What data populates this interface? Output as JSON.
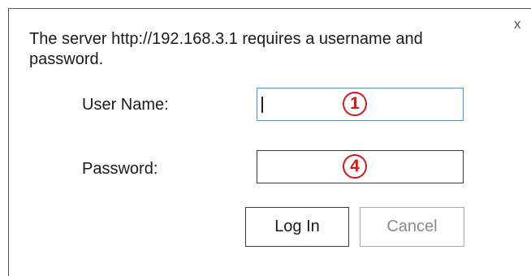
{
  "dialog": {
    "close_label": "x",
    "message": "The server http://192.168.3.1 requires a username and password.",
    "username": {
      "label": "User Name:",
      "value": "",
      "marker": "1"
    },
    "password": {
      "label": "Password:",
      "value": "",
      "marker": "4"
    },
    "buttons": {
      "login": "Log In",
      "cancel": "Cancel"
    }
  },
  "colors": {
    "focus_border": "#5c8fd6",
    "marker": "#d11919",
    "disabled_text": "#8a8a8a"
  }
}
